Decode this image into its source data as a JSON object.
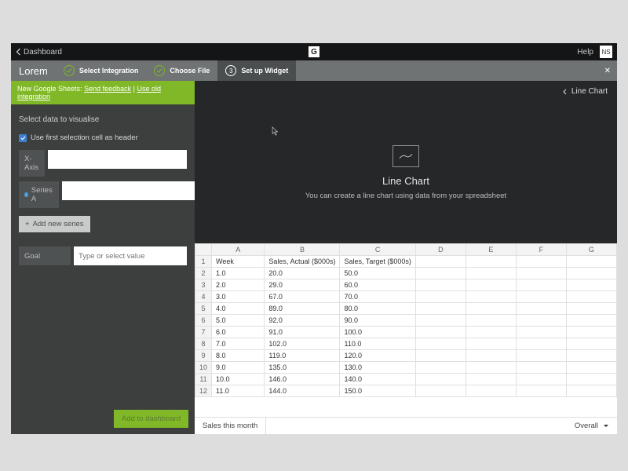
{
  "top": {
    "back": "Dashboard",
    "brand_letter": "G",
    "help": "Help",
    "avatar": "NS"
  },
  "steps": {
    "title": "Lorem",
    "s1": "Select Integration",
    "s2": "Choose File",
    "s3_num": "3",
    "s3": "Set up Widget"
  },
  "banner": {
    "prefix": "New Google Sheets:",
    "link1": "Send feedback",
    "sep": " | ",
    "link2": "Use old integration"
  },
  "side": {
    "heading": "Select data to visualise",
    "use_header": "Use first selection cell as header",
    "xaxis": "X-Axis",
    "seriesA": "Series A",
    "add_series": "Add new series",
    "goal": "Goal",
    "goal_ph": "Type or select value",
    "add_dash": "Add to dashboard"
  },
  "crumb": {
    "label": "Line Chart"
  },
  "preview": {
    "title": "Line Chart",
    "desc": "You can create a line chart using data from your spreadsheet"
  },
  "sheet": {
    "cols": [
      "A",
      "B",
      "C",
      "D",
      "E",
      "F",
      "G"
    ],
    "rows": [
      [
        "Week",
        "Sales, Actual ($000s)",
        "Sales, Target ($000s)",
        "",
        "",
        "",
        ""
      ],
      [
        "1.0",
        "20.0",
        "50.0",
        "",
        "",
        "",
        ""
      ],
      [
        "2.0",
        "29.0",
        "60.0",
        "",
        "",
        "",
        ""
      ],
      [
        "3.0",
        "67.0",
        "70.0",
        "",
        "",
        "",
        ""
      ],
      [
        "4.0",
        "89.0",
        "80.0",
        "",
        "",
        "",
        ""
      ],
      [
        "5.0",
        "92.0",
        "90.0",
        "",
        "",
        "",
        ""
      ],
      [
        "6.0",
        "91.0",
        "100.0",
        "",
        "",
        "",
        ""
      ],
      [
        "7.0",
        "102.0",
        "110.0",
        "",
        "",
        "",
        ""
      ],
      [
        "8.0",
        "119.0",
        "120.0",
        "",
        "",
        "",
        ""
      ],
      [
        "9.0",
        "135.0",
        "130.0",
        "",
        "",
        "",
        ""
      ],
      [
        "10.0",
        "146.0",
        "140.0",
        "",
        "",
        "",
        ""
      ],
      [
        "11.0",
        "144.0",
        "150.0",
        "",
        "",
        "",
        ""
      ]
    ],
    "tab": "Sales this month",
    "overall": "Overall"
  }
}
